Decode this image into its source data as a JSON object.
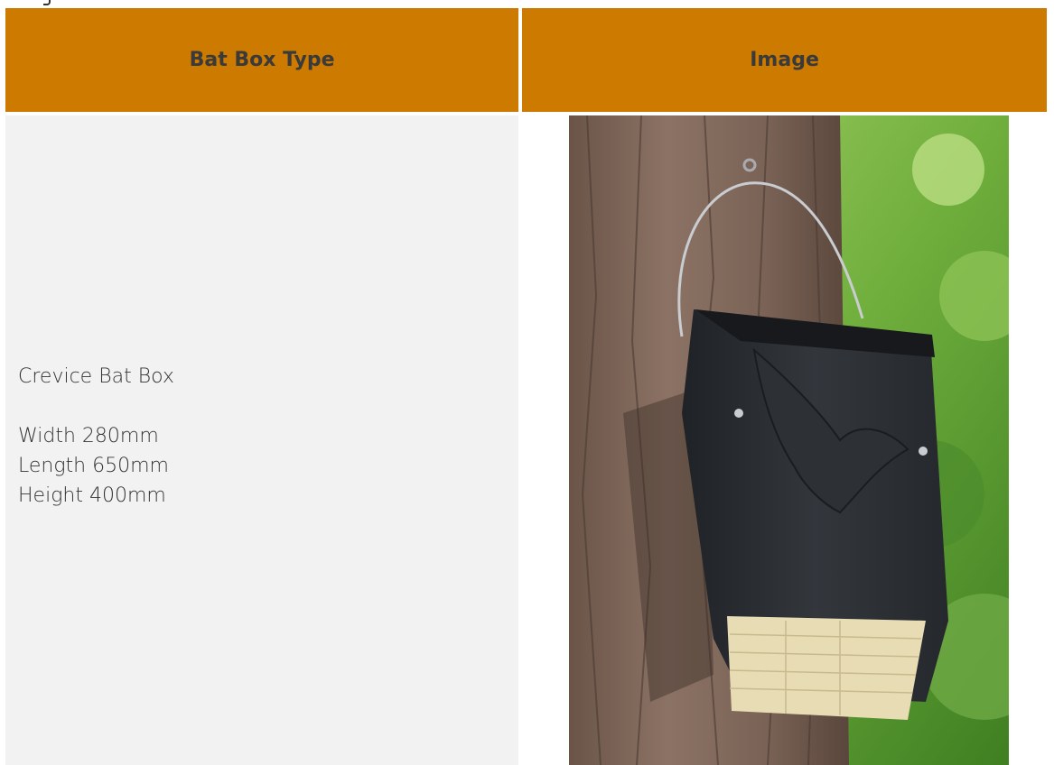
{
  "table": {
    "headers": [
      "Bat Box Type",
      "Image"
    ],
    "rows": [
      {
        "name": "Crevice Bat Box",
        "specs": [
          "Width 280mm",
          "Length 650mm",
          "Height 400mm"
        ],
        "image_icon": "bat-box-photo"
      }
    ]
  },
  "colors": {
    "header_bg": "#cc7a00",
    "header_text": "#3a3a3a",
    "cell_bg": "#f2f2f2",
    "body_text": "#333333"
  }
}
